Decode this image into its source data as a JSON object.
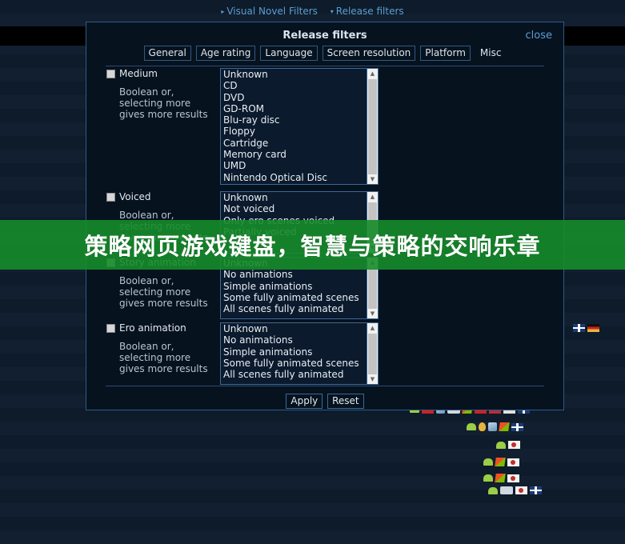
{
  "topnav": {
    "items": [
      {
        "label": "Visual Novel Filters",
        "icon": "caret-right-icon"
      },
      {
        "label": "Release filters",
        "icon": "caret-down-icon"
      }
    ]
  },
  "dialog": {
    "title": "Release filters",
    "close_label": "close",
    "tabs": [
      {
        "label": "General",
        "active": false
      },
      {
        "label": "Age rating",
        "active": false
      },
      {
        "label": "Language",
        "active": false
      },
      {
        "label": "Screen resolution",
        "active": false
      },
      {
        "label": "Platform",
        "active": false
      },
      {
        "label": "Misc",
        "active": true
      }
    ],
    "hint_text": "Boolean or, selecting more gives more results",
    "filters": [
      {
        "label": "Medium",
        "checked": false,
        "hint": "Boolean or, selecting more gives more results",
        "options": [
          "Unknown",
          "CD",
          "DVD",
          "GD-ROM",
          "Blu-ray disc",
          "Floppy",
          "Cartridge",
          "Memory card",
          "UMD",
          "Nintendo Optical Disc"
        ]
      },
      {
        "label": "Voiced",
        "checked": false,
        "hint": "Boolean or, selecting more gives more results",
        "options": [
          "Unknown",
          "Not voiced",
          "Only ero scenes voiced",
          "Partially voiced"
        ]
      },
      {
        "label": "Story animation",
        "checked": false,
        "hint": "Boolean or, selecting more gives more results",
        "options": [
          "Unknown",
          "No animations",
          "Simple animations",
          "Some fully animated scenes",
          "All scenes fully animated"
        ]
      },
      {
        "label": "Ero animation",
        "checked": false,
        "hint": "Boolean or, selecting more gives more results",
        "options": [
          "Unknown",
          "No animations",
          "Simple animations",
          "Some fully animated scenes",
          "All scenes fully animated"
        ]
      }
    ],
    "footer": {
      "apply_label": "Apply",
      "reset_label": "Reset"
    }
  },
  "banner": {
    "text": "策略网页游戏键盘，智慧与策略的交响乐章",
    "background_color": "#168c2a",
    "text_color": "#ffffff"
  },
  "colors": {
    "page_bg": "#0d1b2b",
    "dialog_bg": "#07121f",
    "dialog_border": "#2e5a86",
    "link": "#5a9fd4",
    "text": "#e2e9f1",
    "listbox_bg": "#0b1a2c",
    "scrollbar_track": "#f1f1f1",
    "scrollbar_thumb": "#c3c3c3"
  }
}
